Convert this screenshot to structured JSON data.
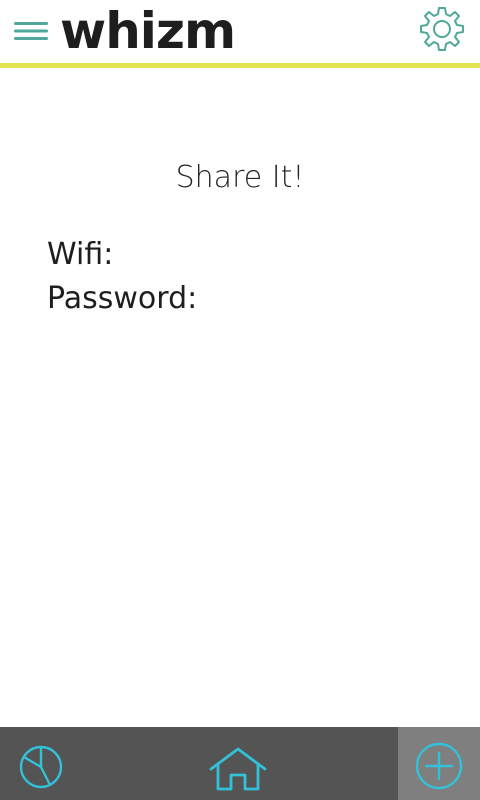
{
  "header": {
    "logo_text": "whizm",
    "menu_icon": "hamburger-menu-icon",
    "settings_icon": "gear-icon",
    "accent_color": "#e3e353",
    "icon_color": "#4fa89a"
  },
  "main": {
    "title": "Share It!",
    "fields": [
      {
        "label": "Wifi:",
        "value": ""
      },
      {
        "label": "Password:",
        "value": ""
      }
    ]
  },
  "bottom_nav": {
    "background_color": "#545454",
    "icon_color": "#33c1d9",
    "items": [
      {
        "icon": "pie-chart-icon"
      },
      {
        "icon": "home-icon"
      },
      {
        "icon": "plus-circle-icon",
        "selected": true
      }
    ]
  }
}
